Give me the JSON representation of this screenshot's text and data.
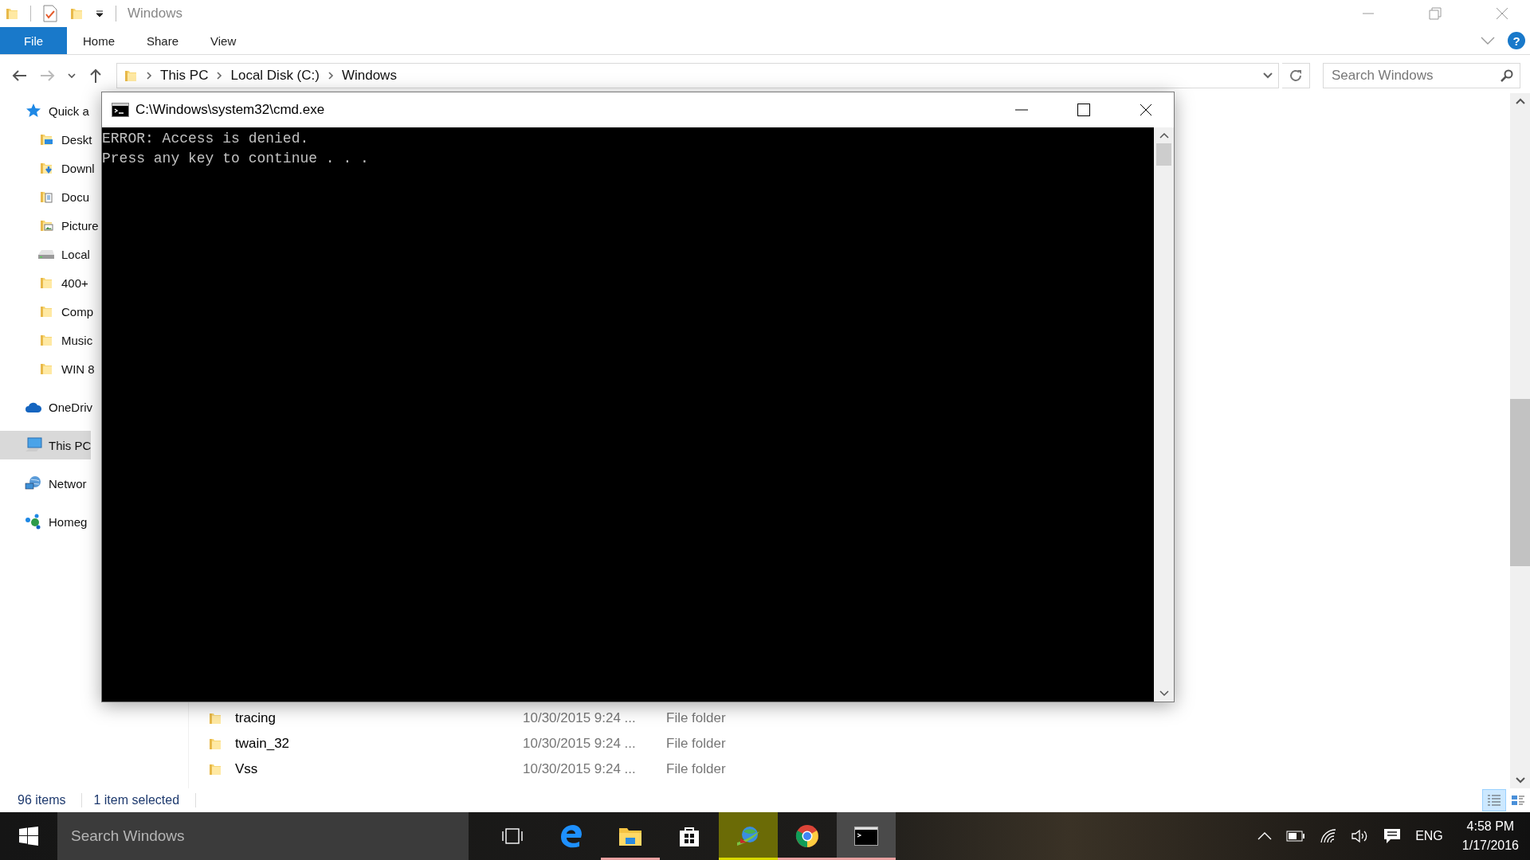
{
  "explorer": {
    "title": "Windows",
    "help": "?",
    "file_tab": "File",
    "tabs": [
      {
        "label": "Home",
        "selected": false
      },
      {
        "label": "Share",
        "selected": false
      },
      {
        "label": "View",
        "selected": false
      }
    ],
    "nav": {
      "back_disabled": false,
      "forward_disabled": true
    },
    "address": {
      "crumbs": [
        "This PC",
        "Local Disk (C:)",
        "Windows"
      ]
    },
    "search": {
      "placeholder": "Search Windows"
    },
    "sidebar": {
      "items": [
        {
          "label": "Quick a",
          "kind": "star",
          "selected": false,
          "children": [
            {
              "label": "Deskt",
              "kind": "desktop",
              "selected": false
            },
            {
              "label": "Downl",
              "kind": "downloads",
              "selected": false
            },
            {
              "label": "Docu",
              "kind": "documents",
              "selected": false
            },
            {
              "label": "Picture",
              "kind": "pictures",
              "selected": false
            },
            {
              "label": "Local",
              "kind": "drive",
              "selected": false
            },
            {
              "label": "400+",
              "kind": "folder",
              "selected": false
            },
            {
              "label": "Comp",
              "kind": "folder",
              "selected": false
            },
            {
              "label": "Music",
              "kind": "folder",
              "selected": false
            },
            {
              "label": "WIN 8",
              "kind": "folder",
              "selected": false
            }
          ]
        },
        {
          "label": "OneDriv",
          "kind": "cloud",
          "selected": false
        },
        {
          "label": "This PC",
          "kind": "pc",
          "selected": true
        },
        {
          "label": "Networ",
          "kind": "network",
          "selected": false
        },
        {
          "label": "Homeg",
          "kind": "homegroup",
          "selected": false
        }
      ]
    },
    "files": [
      {
        "name": "tracing",
        "date": "10/30/2015 9:24 ...",
        "type": "File folder",
        "selected": false
      },
      {
        "name": "twain_32",
        "date": "10/30/2015 9:24 ...",
        "type": "File folder",
        "selected": false
      },
      {
        "name": "Vss",
        "date": "10/30/2015 9:24 ...",
        "type": "File folder",
        "selected": false
      }
    ],
    "status_bar": {
      "count": "96 items",
      "selection": "1 item selected"
    },
    "views": [
      {
        "kind": "details",
        "selected": true
      },
      {
        "kind": "tiles",
        "selected": false
      }
    ]
  },
  "cmd": {
    "title": "C:\\Windows\\system32\\cmd.exe",
    "lines": [
      "ERROR: Access is denied.",
      "Press any key to continue . . ."
    ]
  },
  "taskbar": {
    "search": {
      "placeholder": "Search Windows"
    },
    "apps": [
      {
        "kind": "taskview",
        "running": false,
        "active": false,
        "flashing": false
      },
      {
        "kind": "edge",
        "running": false,
        "active": false,
        "flashing": false
      },
      {
        "kind": "explorer",
        "running": true,
        "active": false,
        "flashing": false
      },
      {
        "kind": "store",
        "running": false,
        "active": false,
        "flashing": false
      },
      {
        "kind": "globe",
        "running": false,
        "active": false,
        "flashing": true
      },
      {
        "kind": "chrome",
        "running": true,
        "active": false,
        "flashing": false
      },
      {
        "kind": "cmd",
        "running": true,
        "active": true,
        "flashing": false
      }
    ],
    "language": "ENG",
    "time": "4:58 PM",
    "date": "1/17/2016"
  }
}
